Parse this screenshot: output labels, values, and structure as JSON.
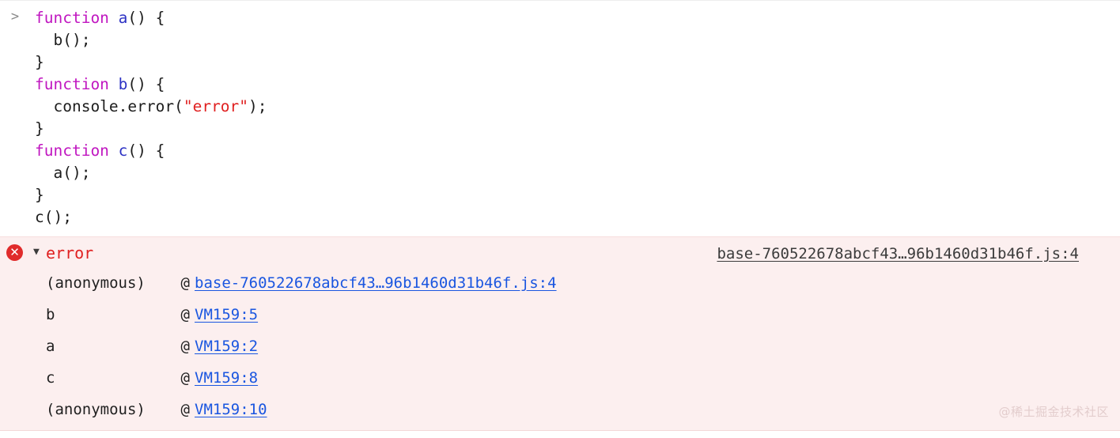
{
  "theme": {
    "page_background": "#ffffff",
    "error_background": "#fcefef",
    "error_border_top": "#f7dede",
    "error_border_bottom": "#f3d7d7",
    "top_divider": "#ededed",
    "error_red": "#e02020",
    "error_icon_red": "#e02b2b",
    "link_blue": "#1a56e0",
    "link_dark": "#3b3b3b",
    "keyword_magenta": "#c016c0",
    "identifier_blue": "#2d32c4",
    "string_red": "#e02020",
    "code_default": "#1c1c1c",
    "watermark_color": "#e3cdcd"
  },
  "input": {
    "prompt_symbol": ">",
    "prompt_icon": "chevron-right-icon",
    "lines": [
      [
        {
          "t": "function",
          "c": "tok-kw"
        },
        {
          "t": " ",
          "c": "tok-plain"
        },
        {
          "t": "a",
          "c": "tok-fn"
        },
        {
          "t": "() {",
          "c": "tok-plain"
        }
      ],
      [
        {
          "t": "  b();",
          "c": "tok-plain"
        }
      ],
      [
        {
          "t": "}",
          "c": "tok-plain"
        }
      ],
      [
        {
          "t": "function",
          "c": "tok-kw"
        },
        {
          "t": " ",
          "c": "tok-plain"
        },
        {
          "t": "b",
          "c": "tok-fn"
        },
        {
          "t": "() {",
          "c": "tok-plain"
        }
      ],
      [
        {
          "t": "  console.error(",
          "c": "tok-plain"
        },
        {
          "t": "\"error\"",
          "c": "tok-str"
        },
        {
          "t": ");",
          "c": "tok-plain"
        }
      ],
      [
        {
          "t": "}",
          "c": "tok-plain"
        }
      ],
      [
        {
          "t": "function",
          "c": "tok-kw"
        },
        {
          "t": " ",
          "c": "tok-plain"
        },
        {
          "t": "c",
          "c": "tok-fn"
        },
        {
          "t": "() {",
          "c": "tok-plain"
        }
      ],
      [
        {
          "t": "  a();",
          "c": "tok-plain"
        }
      ],
      [
        {
          "t": "}",
          "c": "tok-plain"
        }
      ],
      [
        {
          "t": "c();",
          "c": "tok-plain"
        }
      ]
    ]
  },
  "error_message": {
    "icon": "error-circle-icon",
    "disclosure_symbol": "▼",
    "expanded": true,
    "title": "error",
    "source_link": "base-760522678abcf43…96b1460d31b46f.js:4",
    "stack": [
      {
        "function": "(anonymous)",
        "at": "@",
        "location": "base-760522678abcf43…96b1460d31b46f.js:4"
      },
      {
        "function": "b",
        "at": "@",
        "location": "VM159:5"
      },
      {
        "function": "a",
        "at": "@",
        "location": "VM159:2"
      },
      {
        "function": "c",
        "at": "@",
        "location": "VM159:8"
      },
      {
        "function": "(anonymous)",
        "at": "@",
        "location": "VM159:10"
      }
    ]
  },
  "watermark": {
    "text": "@稀土掘金技术社区"
  }
}
